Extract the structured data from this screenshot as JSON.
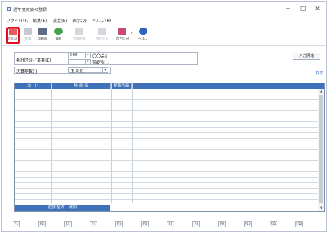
{
  "window": {
    "title": "過年度実績の登録",
    "minimize": "−",
    "maximize": "□",
    "close": "✕"
  },
  "menu": [
    "ファイル(F)",
    "編集(E)",
    "設定(S)",
    "表示(V)",
    "ヘルプ(H)"
  ],
  "toolbar": {
    "items": [
      {
        "label": "閉じる",
        "icon": "close-doc-icon",
        "color": "#e9595f",
        "disabled": false
      },
      {
        "label": "登録",
        "icon": "save-icon",
        "color": "#9aa6b6",
        "disabled": true
      },
      {
        "label": "印刷等",
        "icon": "printer-icon",
        "color": "#5a6c86",
        "disabled": false
      },
      {
        "label": "最新",
        "icon": "refresh-icon",
        "color": "#48a24b",
        "disabled": false
      },
      {
        "label": "全部削除",
        "icon": "delete-icon",
        "color": "#a8b0bb",
        "disabled": true
      },
      {
        "label": "会計区分",
        "icon": "accounts-icon",
        "color": "#a8b0bb",
        "disabled": true
      },
      {
        "label": "出力区分",
        "icon": "output-icon",
        "color": "#c84a7a",
        "disabled": false
      },
      {
        "label": "ヘルプ",
        "icon": "help-icon",
        "color": "#2e63c2",
        "disabled": false
      }
    ],
    "output_dropdown": "▾"
  },
  "form": {
    "account_label": "会計区分／事業(E)",
    "account_code": "000",
    "account_name": "〇〇会計",
    "business_code": "",
    "business_name": "指定なし",
    "period_label": "決算期数(I)",
    "period_value": "第 9 期",
    "input_start_button": "入力開始",
    "link_label": "月次",
    "dropdown_glyph": "▾"
  },
  "grid": {
    "columns": [
      "コード",
      "科 目 名",
      "期首残高",
      ""
    ],
    "row_count": 21,
    "footer_label": "差額(借方 - 貸方)",
    "scroll_up": "▲",
    "scroll_down": "▼"
  },
  "function_keys": [
    "F1",
    "F2",
    "F3",
    "F4",
    "F5",
    "F6",
    "F7",
    "F8",
    "F9",
    "F10",
    "F11",
    "F12"
  ]
}
